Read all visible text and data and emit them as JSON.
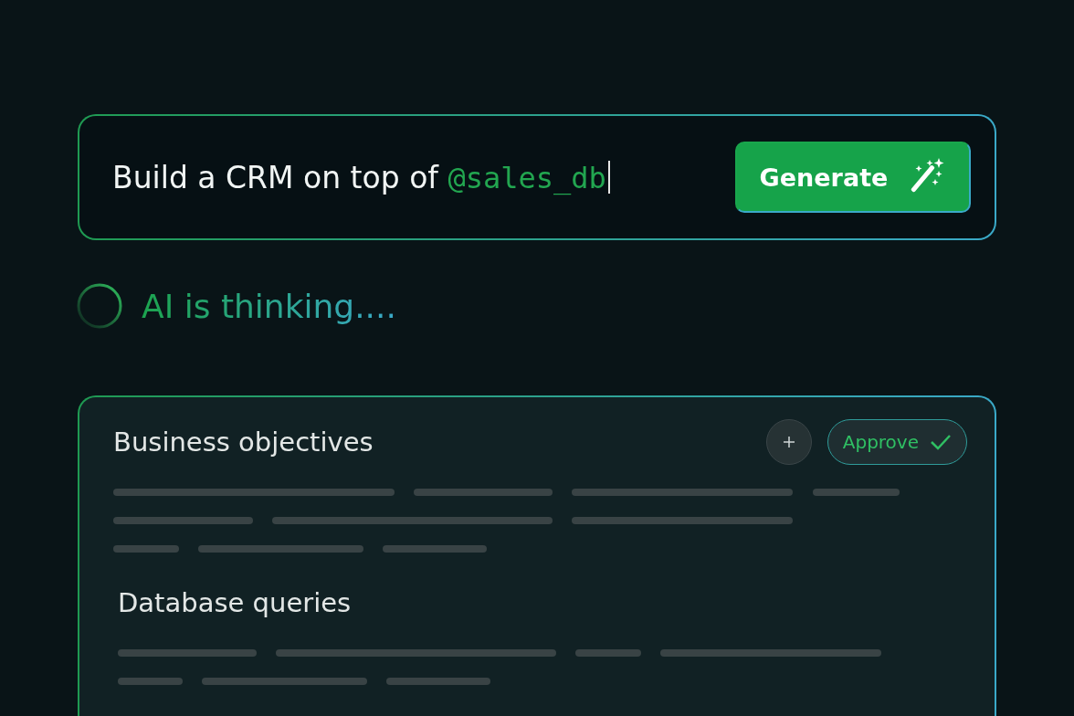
{
  "prompt": {
    "text": "Build a CRM on top of",
    "mention": "@sales_db",
    "button": "Generate"
  },
  "status": {
    "text": "AI is thinking....",
    "busy": true
  },
  "card": {
    "add_button": true,
    "approve": "Approve",
    "sections": [
      {
        "title": "Business objectives"
      },
      {
        "title": "Database queries"
      }
    ]
  }
}
